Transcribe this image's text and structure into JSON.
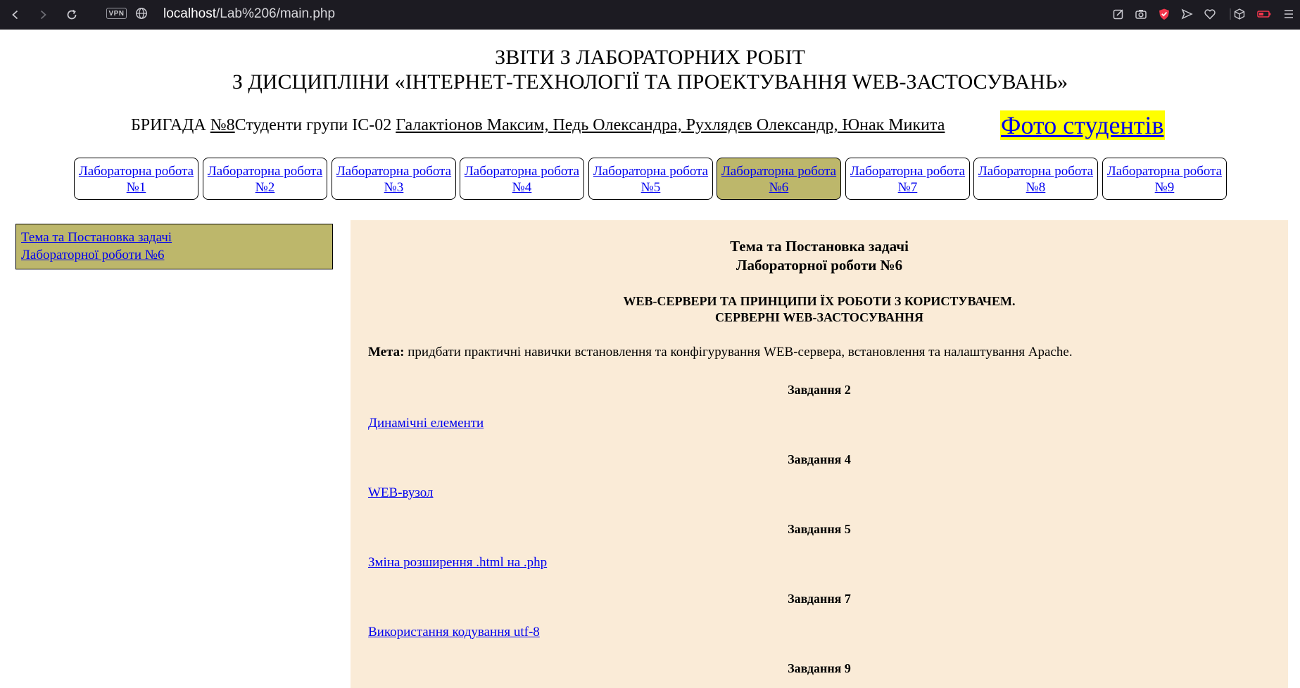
{
  "browser": {
    "url_host": "localhost",
    "url_path": "/Lab%206/main.php",
    "vpn_label": "VPN"
  },
  "header": {
    "title_line1": "ЗВІТИ З ЛАБОРАТОРНИХ РОБІТ",
    "title_line2": "З ДИСЦИПЛІНИ «ІНТЕРНЕТ-ТЕХНОЛОГІЇ ТА ПРОЕКТУВАННЯ WEB-ЗАСТОСУВАНЬ»",
    "brigade_prefix": "БРИГАДА ",
    "brigade_number": "№8",
    "students_prefix": "Студенти групи ІС-02 ",
    "students_names": "Галактіонов Максим, Педь Олександра, Рухлядєв Олександр, Юнак Микита",
    "photo_link": "Фото студентів"
  },
  "lab_nav": [
    {
      "line1": "Лабораторна робота",
      "line2": "№1",
      "active": false
    },
    {
      "line1": "Лабораторна робота",
      "line2": "№2",
      "active": false
    },
    {
      "line1": "Лабораторна робота",
      "line2": "№3",
      "active": false
    },
    {
      "line1": "Лабораторна робота",
      "line2": "№4",
      "active": false
    },
    {
      "line1": "Лабораторна робота",
      "line2": "№5",
      "active": false
    },
    {
      "line1": "Лабораторна робота",
      "line2": "№6",
      "active": true
    },
    {
      "line1": "Лабораторна робота",
      "line2": "№7",
      "active": false
    },
    {
      "line1": "Лабораторна робота",
      "line2": "№8",
      "active": false
    },
    {
      "line1": "Лабораторна робота",
      "line2": "№9",
      "active": false
    }
  ],
  "sidebar": {
    "link_line1": "Тема та Постановка задачі",
    "link_line2": "Лабораторної роботи №6"
  },
  "main": {
    "heading_line1": "Тема та Постановка задачі",
    "heading_line2": "Лабораторної роботи №6",
    "topic_line1": "WEB-СЕРВЕРИ ТА ПРИНЦИПИ ЇХ РОБОТИ З КОРИСТУВАЧЕМ.",
    "topic_line2": "СЕРВЕРНІ WEB-ЗАСТОСУВАННЯ",
    "goal_label": "Мета:",
    "goal_text": " придбати практичні навички встановлення та конфігурування WEB-сервера, встановлення та налаштування Apache.",
    "tasks": [
      {
        "title": "Завдання 2",
        "link": "Динамічні елементи"
      },
      {
        "title": "Завдання 4",
        "link": "WEB-вузол"
      },
      {
        "title": "Завдання 5",
        "link": "Зміна розширення .html на .php"
      },
      {
        "title": "Завдання 7",
        "link": "Використання кодування utf-8"
      },
      {
        "title": "Завдання 9",
        "link": ""
      }
    ]
  },
  "colors": {
    "active_tab_bg": "#bdb76b",
    "main_bg": "#faebd7",
    "photo_highlight": "#ffff00",
    "link": "#0000ee",
    "browser_bar": "#1c1b22"
  }
}
